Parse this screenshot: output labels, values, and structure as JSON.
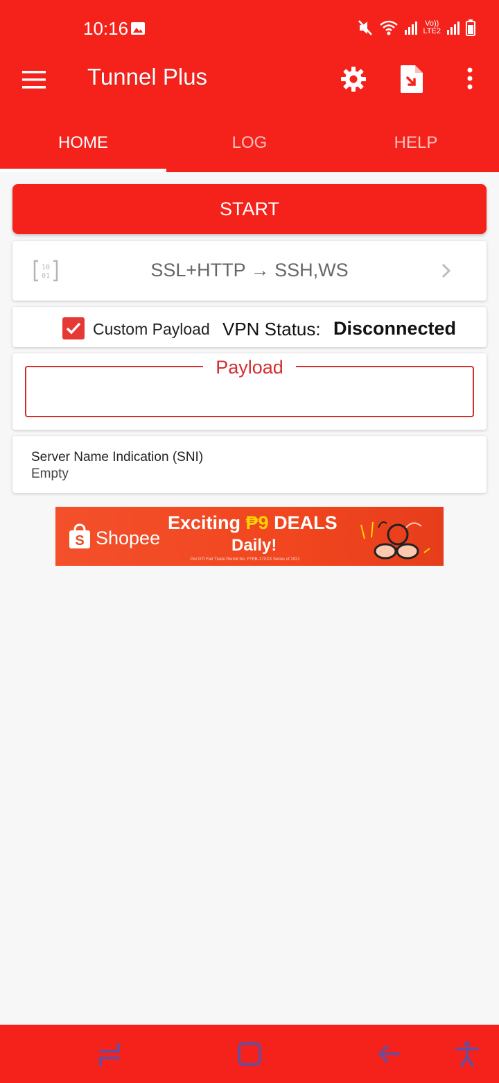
{
  "status_bar": {
    "time": "10:16",
    "network_label_line1": "Vo))",
    "network_label_line2": "LTE2",
    "icons": [
      "image-icon",
      "mute-icon",
      "wifi-icon",
      "signal-icon",
      "battery-icon"
    ]
  },
  "app_bar": {
    "title": "Tunnel Plus",
    "actions": [
      "settings",
      "import-config",
      "more-options"
    ]
  },
  "tabs": [
    {
      "label": "HOME",
      "active": true
    },
    {
      "label": "LOG",
      "active": false
    },
    {
      "label": "HELP",
      "active": false
    }
  ],
  "start_button": {
    "label": "START"
  },
  "connection_mode": {
    "label": "SSL+HTTP → SSH,WS"
  },
  "options": {
    "custom_payload_label": "Custom Payload",
    "custom_payload_checked": true,
    "vpn_status_label": "VPN Status:",
    "vpn_status_value": "Disconnected"
  },
  "payload": {
    "legend": "Payload",
    "value": ""
  },
  "sni": {
    "title": "Server Name Indication (SNI)",
    "value": "Empty"
  },
  "ad": {
    "brand": "Shopee",
    "headline_prefix": "Exciting ",
    "headline_peso": "₱9",
    "headline_suffix": " DEALS",
    "subline": "Daily!",
    "fine_print": "Per DTI Fair Trade Permit No. FTEB-17XXX Series of 2021"
  },
  "colors": {
    "accent": "#f5221b",
    "error": "#d32f2f",
    "checkbox": "#e53935"
  }
}
